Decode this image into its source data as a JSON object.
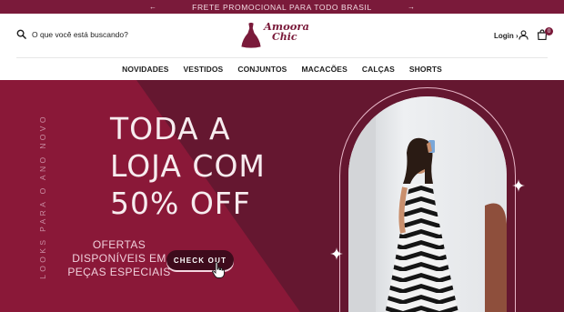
{
  "announcement": {
    "text": "FRETE PROMOCIONAL PARA TODO BRASIL",
    "prev_icon": "arrow-left-icon",
    "next_icon": "arrow-right-icon"
  },
  "header": {
    "search_placeholder": "O que você está buscando?",
    "logo": {
      "line1": "Amoora",
      "line2": "Chic"
    },
    "login_label": "Login",
    "login_arrow": "›",
    "cart_count": "0"
  },
  "nav": {
    "items": [
      "NOVIDADES",
      "VESTIDOS",
      "CONJUNTOS",
      "MACACÕES",
      "CALÇAS",
      "SHORTS"
    ]
  },
  "hero": {
    "vertical_text": "LOOKS PARA O ANO NOVO",
    "headline": [
      "TODA A",
      "LOJA COM",
      "50% OFF"
    ],
    "offer": [
      "OFERTAS",
      "DISPONÍVEIS EM",
      "PEÇAS ESPECIAIS"
    ],
    "cta_label": "CHECK OUT"
  },
  "colors": {
    "brand": "#7a1a3a",
    "hero_light": "#8a1838",
    "hero_dark": "#651730",
    "cta": "#3e0b1c"
  }
}
